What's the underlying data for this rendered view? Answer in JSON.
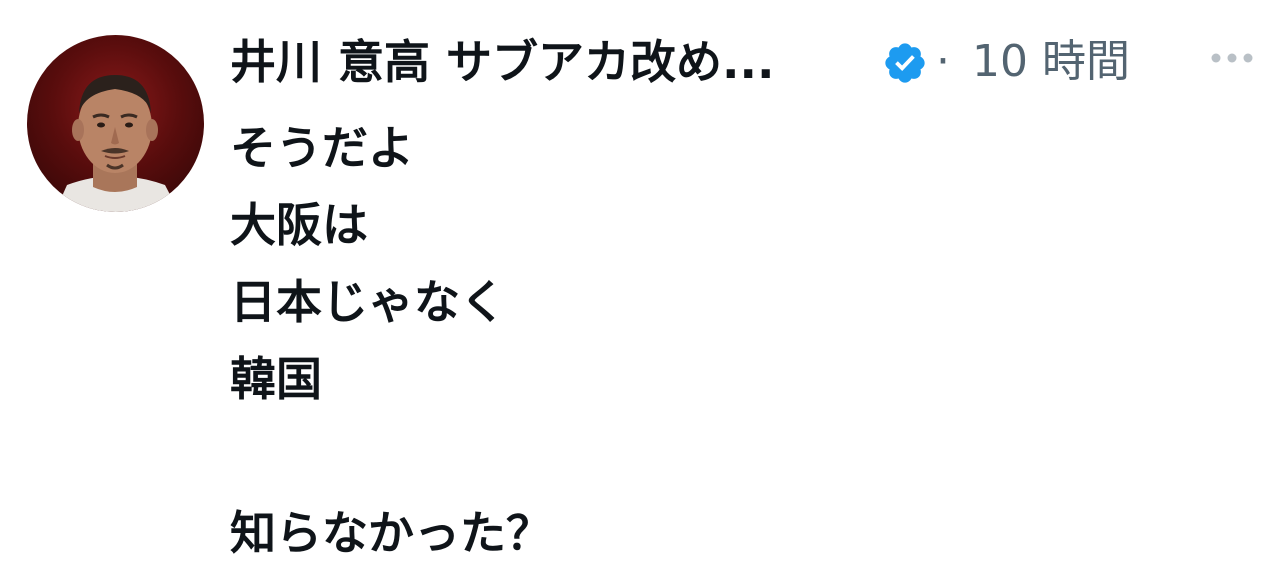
{
  "tweet": {
    "author_name": "井川 意高 サブアカ改め...",
    "verified_icon": "verified-badge-icon",
    "separator": "·",
    "timestamp": "10 時間",
    "more_icon": "more-dots-icon",
    "lines": [
      "そうだよ",
      "大阪は",
      "日本じゃなく",
      "韓国",
      "",
      "知らなかった？"
    ]
  },
  "colors": {
    "text_primary": "#0f1419",
    "text_secondary": "#536471",
    "verified_blue": "#1d9bf0",
    "more_dots": "#b9c0c6"
  }
}
